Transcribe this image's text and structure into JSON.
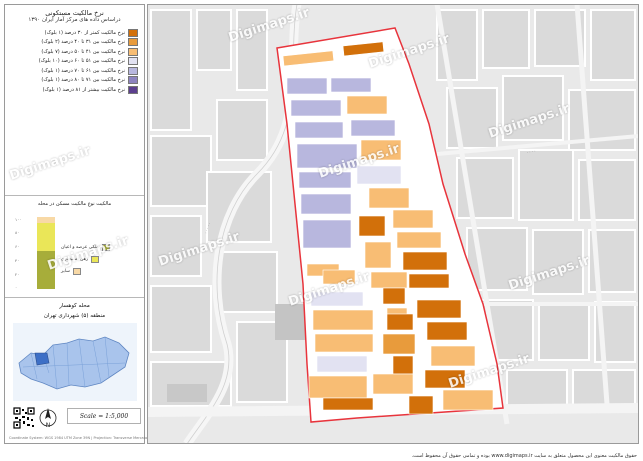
{
  "sidebar": {
    "title": "نرخ مالکیت مستکونی",
    "subtitle": "دراساس داده های مرکز آمار ایران ۱۳۹۰",
    "legend": [
      {
        "label": "نرخ مالکیت کمتر از ۳۰ درصد (۱ بلوک)",
        "color": "#d2700a"
      },
      {
        "label": "نرخ مالکیت بین ۳۱ تا ۴۰ درصد (۲ بلوک)",
        "color": "#e89b3c"
      },
      {
        "label": "نرخ مالکیت بین ۴۱ تا ۵۰ درصد (۷ بلوک)",
        "color": "#f8bd74"
      },
      {
        "label": "نرخ مالکیت بین ۵۱ تا ۶۰ درصد (۱۰ بلوک)",
        "color": "#e2e2f2"
      },
      {
        "label": "نرخ مالکیت بین ۶۱ تا ۷۰ درصد (۱ بلوک)",
        "color": "#b8b7de"
      },
      {
        "label": "نرخ مالکیت بین ۷۱ تا ۸۰ درصد (۱ بلوک)",
        "color": "#8d83bf"
      },
      {
        "label": "نرخ مالکیت بیشتر از ۸۱ درصد (۱ بلوک)",
        "color": "#5c3f8e"
      }
    ],
    "stack_title": "مالکیت نوع مالکیت مسکن در محله",
    "stack_ticks": [
      "۱۰۰",
      "۸۰",
      "۶۰",
      "۴۰",
      "۲۰",
      "۰"
    ],
    "stack_legend": [
      {
        "label": "ملکی عرصه و اعیان",
        "color": "#a7ad3a"
      },
      {
        "label": "رهن استیجاری",
        "color": "#eae658"
      },
      {
        "label": "سایر",
        "color": "#f8d9a6"
      }
    ],
    "location_title": "محله کوهسار",
    "location_subtitle": "منطقه (۵) شهرداری تهران",
    "scale": "Scale = 1:5,000",
    "footer": "Coordinate System: WGS 1984 UTM Zone 39N | Projection: Transverse Mercator"
  },
  "map": {
    "watermark_text": "Digimaps.ir",
    "boundary_color": "#e8343c",
    "copyright": "حقوق مالکیت معنوی این محصول متعلق به سایت www.digimaps.ir بوده و تمامی حقوق آن محفوظ است."
  }
}
